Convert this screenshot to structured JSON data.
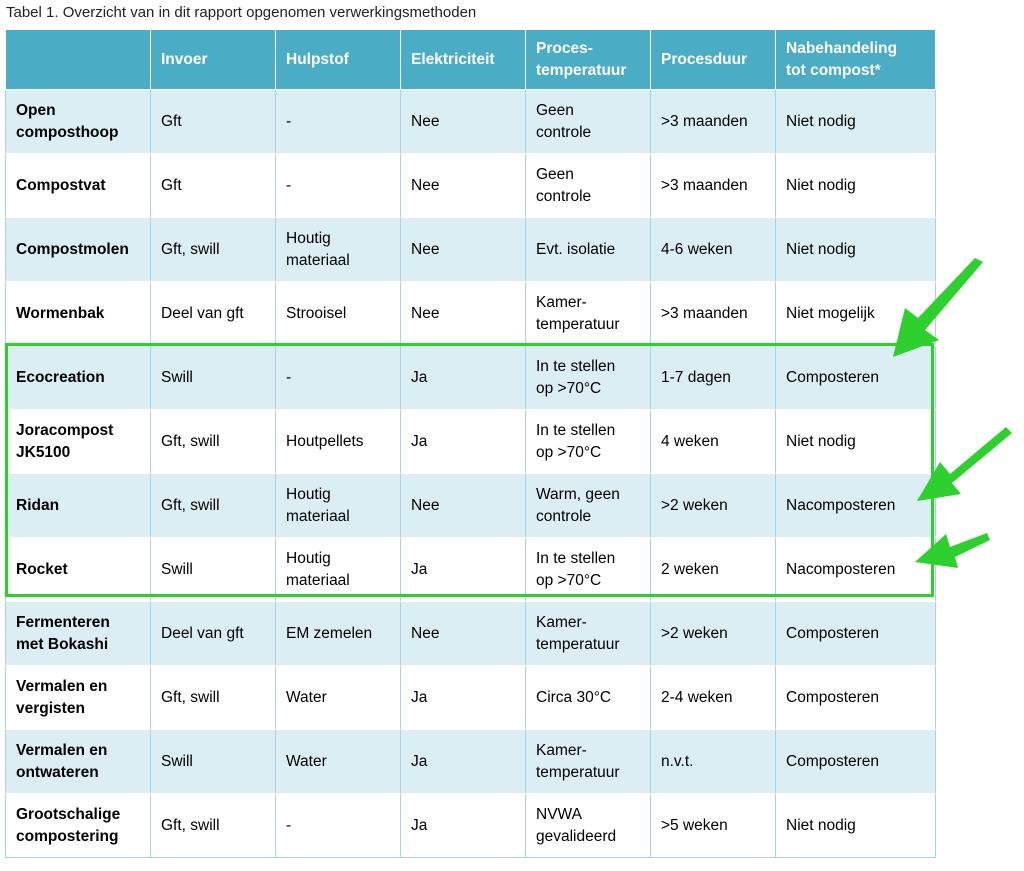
{
  "caption": "Tabel 1. Overzicht van in dit rapport opgenomen verwerkingsmethoden",
  "headers": [
    "",
    "Invoer",
    "Hulpstof",
    "Elektriciteit",
    "Proces-\ntemperatuur",
    "Procesduur",
    "Nabehandeling\ntot compost*"
  ],
  "rows": [
    [
      "Open\ncomposthoop",
      "Gft",
      "-",
      "Nee",
      "Geen\ncontrole",
      ">3 maanden",
      "Niet nodig"
    ],
    [
      "Compostvat",
      "Gft",
      "-",
      "Nee",
      "Geen\ncontrole",
      ">3 maanden",
      "Niet nodig"
    ],
    [
      "Compostmolen",
      "Gft, swill",
      "Houtig\nmateriaal",
      "Nee",
      "Evt. isolatie",
      "4-6 weken",
      "Niet nodig"
    ],
    [
      "Wormenbak",
      "Deel van gft",
      "Strooisel",
      "Nee",
      "Kamer-\ntemperatuur",
      ">3 maanden",
      "Niet mogelijk"
    ],
    [
      "Ecocreation",
      "Swill",
      "-",
      "Ja",
      "In te stellen\nop >70°C",
      "1-7 dagen",
      "Composteren"
    ],
    [
      "Joracompost\nJK5100",
      "Gft, swill",
      "Houtpellets",
      "Ja",
      "In te stellen\nop >70°C",
      "4 weken",
      "Niet nodig"
    ],
    [
      "Ridan",
      "Gft, swill",
      "Houtig\nmateriaal",
      "Nee",
      "Warm, geen\ncontrole",
      ">2 weken",
      "Nacomposteren"
    ],
    [
      "Rocket",
      "Swill",
      "Houtig\nmateriaal",
      "Ja",
      "In te stellen\nop >70°C",
      "2 weken",
      "Nacomposteren"
    ],
    [
      "Fermenteren\nmet Bokashi",
      "Deel van gft",
      "EM zemelen",
      "Nee",
      "Kamer-\ntemperatuur",
      ">2 weken",
      "Composteren"
    ],
    [
      "Vermalen en\nvergisten",
      "Gft, swill",
      "Water",
      "Ja",
      "Circa 30°C",
      "2-4 weken",
      "Composteren"
    ],
    [
      "Vermalen en\nontwateren",
      "Swill",
      "Water",
      "Ja",
      "Kamer-\ntemperatuur",
      "n.v.t.",
      "Composteren"
    ],
    [
      "Grootschalige\ncompostering",
      "Gft, swill",
      "-",
      "Ja",
      "NVWA\ngevalideerd",
      ">5 weken",
      "Niet nodig"
    ]
  ],
  "highlight": {
    "color": "#2ed02e",
    "rows": [
      "Ecocreation",
      "Joracompost JK5100",
      "Ridan",
      "Rocket"
    ]
  },
  "colors": {
    "header_bg": "#4bacc6",
    "band_bg": "#daeef3"
  }
}
